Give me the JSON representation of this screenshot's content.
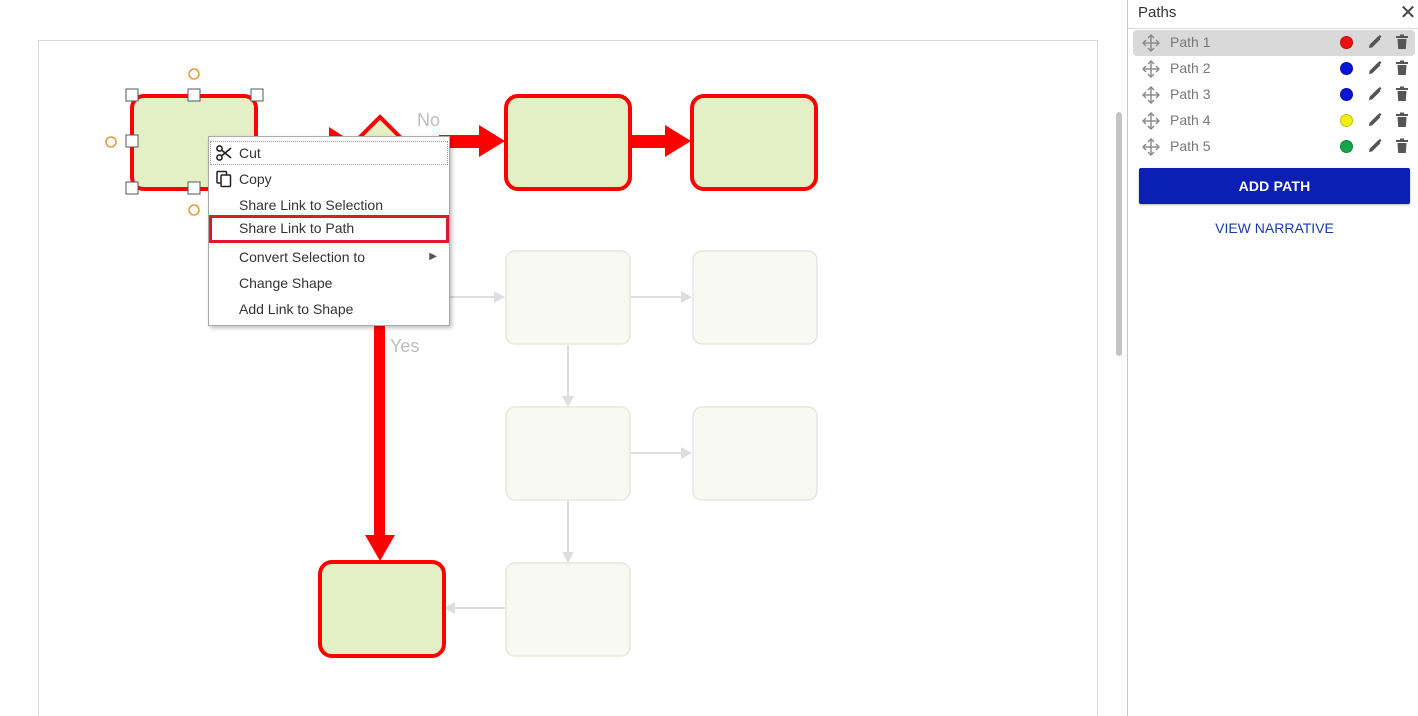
{
  "diagram": {
    "labels": {
      "no": "No",
      "yes": "Yes"
    }
  },
  "context_menu": {
    "items": [
      {
        "label": "Cut",
        "icon": "scissors-icon"
      },
      {
        "label": "Copy",
        "icon": "copy-icon"
      },
      {
        "label": "Share Link to Selection"
      },
      {
        "label": "Share Link to Path",
        "highlighted": true
      },
      {
        "label": "Convert Selection to",
        "submenu_arrow": "▶"
      },
      {
        "label": "Change Shape"
      },
      {
        "label": "Add Link to Shape"
      }
    ]
  },
  "panel": {
    "title": "Paths",
    "close_symbol": "✕",
    "paths": [
      {
        "name": "Path 1",
        "color": "#ee1111",
        "selected": true
      },
      {
        "name": "Path 2",
        "color": "#0a14d8"
      },
      {
        "name": "Path 3",
        "color": "#0a14d8"
      },
      {
        "name": "Path 4",
        "color": "#f2ee10"
      },
      {
        "name": "Path 5",
        "color": "#16a34a"
      }
    ],
    "add_path_label": "ADD PATH",
    "view_narrative_label": "VIEW NARRATIVE"
  },
  "colors": {
    "path_highlight": "#ff0000",
    "shape_fill": "#e3efc4",
    "faded_shape_fill": "#f8f9f2",
    "accent_button": "#0b1fb5",
    "selection_handle": "#e08a1e"
  }
}
